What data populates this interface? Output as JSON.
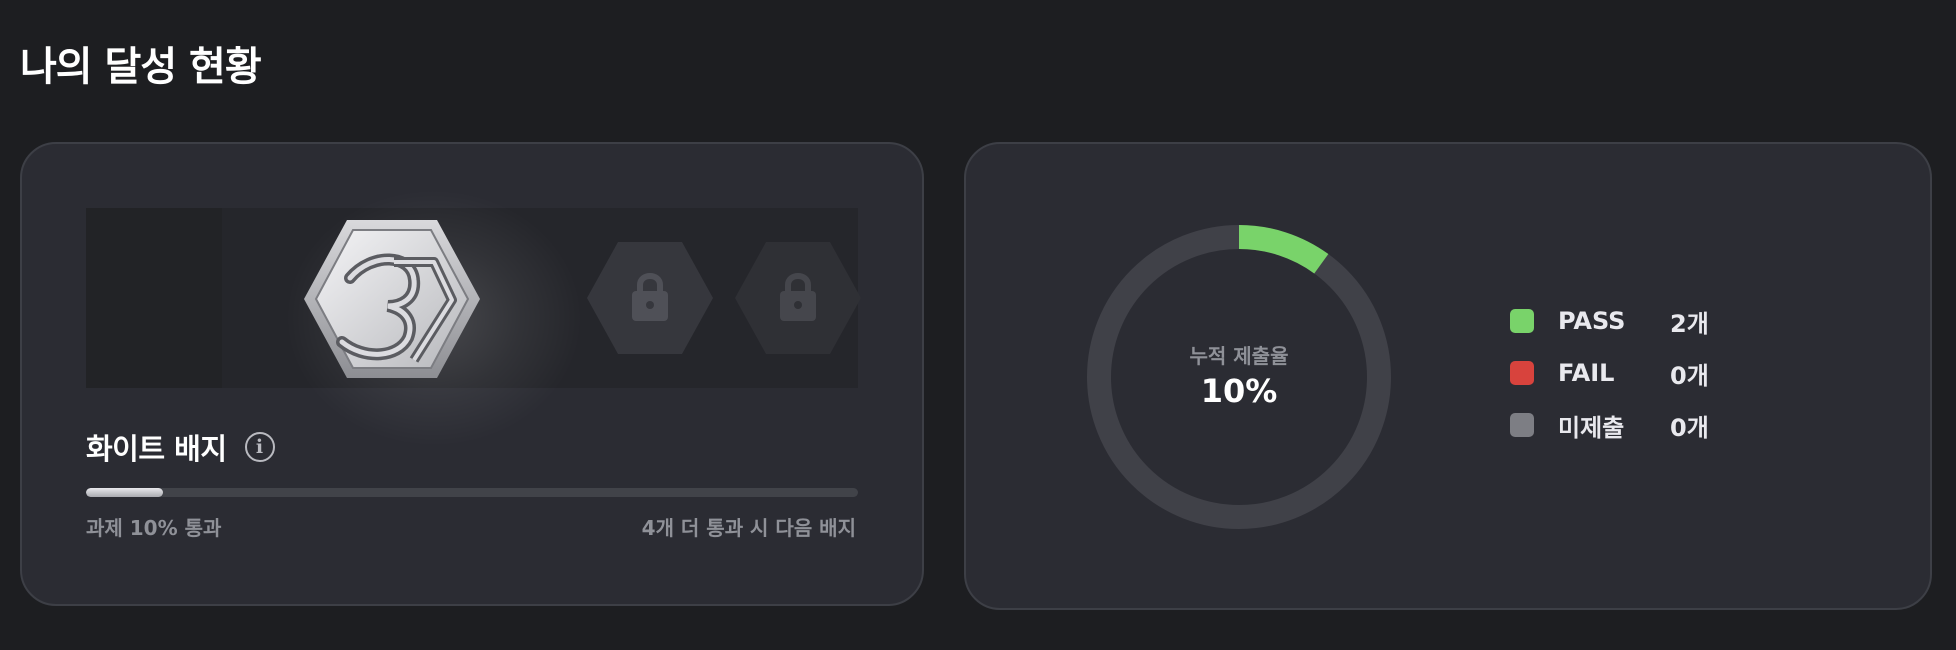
{
  "page": {
    "title": "나의 달성 현황"
  },
  "badge": {
    "name": "화이트 배지",
    "info_icon": "info-icon",
    "progress_fraction": 0.1,
    "progress_left": "과제 10% 통과",
    "progress_right": "4개 더 통과 시 다음 배지",
    "main_badge_icon": "badge-hexagon-icon",
    "locked_icon": "lock-icon"
  },
  "stats": {
    "donut_label": "누적 제출율",
    "donut_value": "10%",
    "rate_fraction": 0.1,
    "legend": [
      {
        "label": "PASS",
        "count": "2개",
        "color": "#79d36a"
      },
      {
        "label": "FAIL",
        "count": "0개",
        "color": "#d8433d"
      },
      {
        "label": "미제출",
        "count": "0개",
        "color": "#7d7e84"
      }
    ],
    "colors": {
      "accent": "#79d36a",
      "track": "#404148"
    }
  }
}
